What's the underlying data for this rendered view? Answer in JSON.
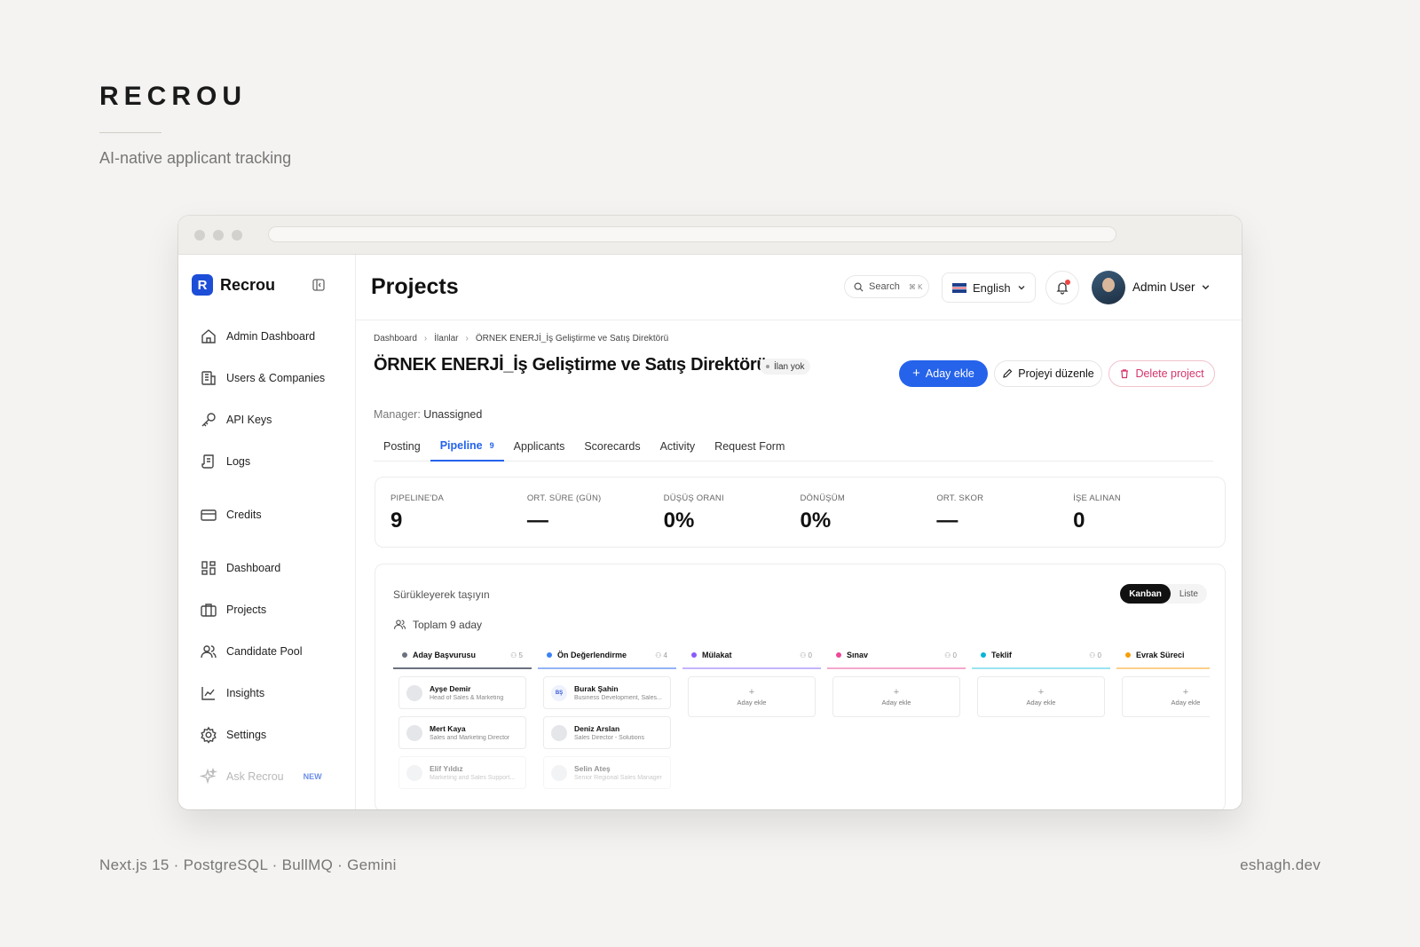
{
  "brand": {
    "title": "RECROU",
    "subtitle": "AI-native applicant tracking"
  },
  "footer": {
    "stack": "Next.js 15 · PostgreSQL · BullMQ · Gemini",
    "site": "eshagh.dev"
  },
  "sidebar": {
    "logo_letter": "R",
    "logo_text": "Recrou",
    "items": [
      {
        "label": "Admin Dashboard",
        "icon": "home-icon"
      },
      {
        "label": "Users & Companies",
        "icon": "building-icon"
      },
      {
        "label": "API Keys",
        "icon": "key-icon"
      },
      {
        "label": "Logs",
        "icon": "scroll-icon"
      },
      {
        "label": "Credits",
        "icon": "credit-card-icon"
      },
      {
        "label": "Dashboard",
        "icon": "grid-icon"
      },
      {
        "label": "Projects",
        "icon": "briefcase-icon"
      },
      {
        "label": "Candidate Pool",
        "icon": "users-icon"
      },
      {
        "label": "Insights",
        "icon": "chart-line-icon"
      },
      {
        "label": "Settings",
        "icon": "gear-icon"
      },
      {
        "label": "Ask Recrou",
        "icon": "sparkle-icon",
        "badge": "NEW"
      }
    ]
  },
  "header": {
    "title": "Projects",
    "search_label": "Search",
    "search_shortcut": "⌘ K",
    "language": "English",
    "user_name": "Admin User"
  },
  "project": {
    "breadcrumb": [
      "Dashboard",
      "İlanlar",
      "ÖRNEK ENERJİ_İş Geliştirme ve Satış Direktörü"
    ],
    "title": "ÖRNEK ENERJİ_İş Geliştirme ve Satış Direktörü",
    "status": "İlan yok",
    "add_candidate": "Aday ekle",
    "edit_project": "Projeyi düzenle",
    "delete_project": "Delete project",
    "manager_label": "Manager:",
    "manager_value": "Unassigned"
  },
  "tabs": [
    {
      "label": "Posting"
    },
    {
      "label": "Pipeline",
      "count": "9",
      "active": true
    },
    {
      "label": "Applicants"
    },
    {
      "label": "Scorecards"
    },
    {
      "label": "Activity"
    },
    {
      "label": "Request Form"
    }
  ],
  "stats": [
    {
      "label": "PIPELINE'DA",
      "value": "9"
    },
    {
      "label": "ORT. SÜRE (GÜN)",
      "value": "—"
    },
    {
      "label": "DÜŞÜŞ ORANI",
      "value": "0%"
    },
    {
      "label": "DÖNÜŞÜM",
      "value": "0%"
    },
    {
      "label": "ORT. SKOR",
      "value": "—"
    },
    {
      "label": "İŞE ALINAN",
      "value": "0"
    }
  ],
  "board": {
    "drag_hint": "Sürükleyerek taşıyın",
    "total": "Toplam 9 aday",
    "view_kanban": "Kanban",
    "view_list": "Liste",
    "add_label": "Aday ekle",
    "columns": [
      {
        "name": "Aday Başvurusu",
        "count": "5",
        "color": "#6b7280",
        "cards": [
          {
            "name": "Ayşe Demir",
            "role": "Head of Sales & Marketing"
          },
          {
            "name": "Mert Kaya",
            "role": "Sales and Marketing Director"
          },
          {
            "name": "Elif Yıldız",
            "role": "Marketing and Sales Support..."
          }
        ]
      },
      {
        "name": "Ön Değerlendirme",
        "count": "4",
        "color": "#3b82f6",
        "cards": [
          {
            "name": "Burak Şahin",
            "role": "Business Development, Sales...",
            "initials": "BŞ"
          },
          {
            "name": "Deniz Arslan",
            "role": "Sales Director - Solutions"
          },
          {
            "name": "Selin Ateş",
            "role": "Senior Regional Sales Manager"
          }
        ]
      },
      {
        "name": "Mülakat",
        "count": "0",
        "color": "#8b5cf6"
      },
      {
        "name": "Sınav",
        "count": "0",
        "color": "#ec4899"
      },
      {
        "name": "Teklif",
        "count": "0",
        "color": "#06b6d4"
      },
      {
        "name": "Evrak Süreci",
        "count": "",
        "color": "#f59e0b"
      }
    ]
  }
}
